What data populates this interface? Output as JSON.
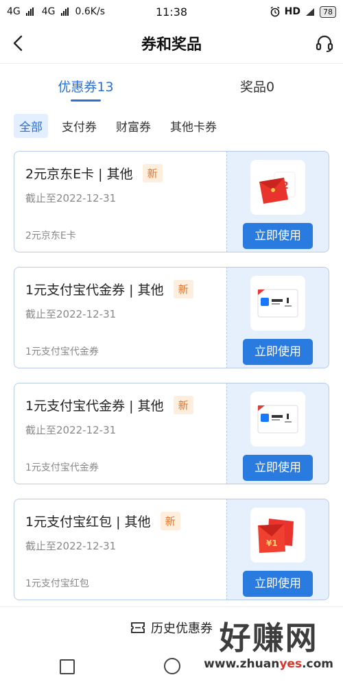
{
  "status_bar": {
    "net1": "4G",
    "net2": "4G",
    "speed": "0.6K/s",
    "time": "11:38",
    "hd": "HD",
    "battery": "78"
  },
  "header": {
    "title": "券和奖品",
    "back_icon": "chevron-left-icon",
    "service_icon": "headset-icon"
  },
  "tabs": [
    {
      "label": "优惠券13",
      "active": true
    },
    {
      "label": "奖品0",
      "active": false
    }
  ],
  "filters": [
    {
      "label": "全部",
      "active": true
    },
    {
      "label": "支付券",
      "active": false
    },
    {
      "label": "财富券",
      "active": false
    },
    {
      "label": "其他卡券",
      "active": false
    }
  ],
  "coupons": [
    {
      "title": "2元京东E卡 | 其他",
      "badge": "新",
      "expire": "截止至2022-12-31",
      "sub": "2元京东E卡",
      "button": "立即使用",
      "thumb": "red-envelope-icon"
    },
    {
      "title": "1元支付宝代金券 | 其他",
      "badge": "新",
      "expire": "截止至2022-12-31",
      "sub": "1元支付宝代金券",
      "button": "立即使用",
      "thumb": "alipay-voucher-icon"
    },
    {
      "title": "1元支付宝代金券 | 其他",
      "badge": "新",
      "expire": "截止至2022-12-31",
      "sub": "1元支付宝代金券",
      "button": "立即使用",
      "thumb": "alipay-voucher-icon"
    },
    {
      "title": "1元支付宝红包 | 其他",
      "badge": "新",
      "expire": "截止至2022-12-31",
      "sub": "1元支付宝红包",
      "button": "立即使用",
      "thumb": "red-packet-icon"
    }
  ],
  "footer": {
    "history_label": "历史优惠券",
    "history_icon": "ticket-icon"
  },
  "watermark": {
    "big": "好赚网",
    "url_a": "www.zhuan",
    "url_b": "yes",
    "url_c": ".com"
  },
  "colors": {
    "accent": "#2a7be0",
    "badge": "#e8742c",
    "card_right_bg": "#e6f0fd"
  }
}
